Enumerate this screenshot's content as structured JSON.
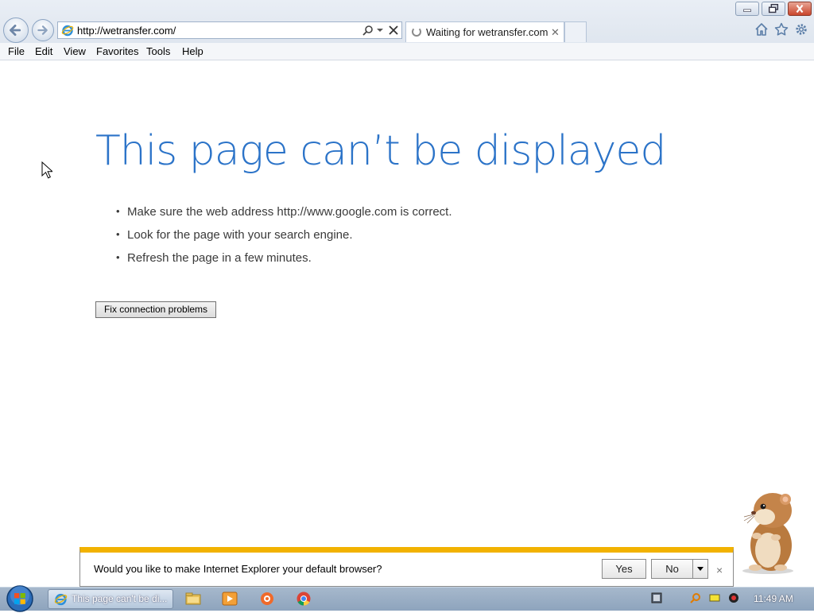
{
  "browser": {
    "address_url": "http://wetransfer.com/",
    "tab_title": "Waiting for wetransfer.com",
    "tab_close": "✕"
  },
  "menu": {
    "items": [
      "File",
      "Edit",
      "View",
      "Favorites",
      "Tools",
      "Help"
    ]
  },
  "error_page": {
    "heading": "This page can’t be displayed",
    "suggestions": [
      "Make sure the web address http://www.google.com is correct.",
      "Look for the page with your search engine.",
      "Refresh the page in a few minutes."
    ],
    "fix_button_label": "Fix connection problems"
  },
  "notification": {
    "message": "Would you like to make Internet Explorer your default browser?",
    "yes_label": "Yes",
    "no_label": "No",
    "close_glyph": "×"
  },
  "taskbar": {
    "active_window_label": "This page can't be di...",
    "clock": "11:49 AM"
  },
  "colors": {
    "heading_blue": "#2b73c8",
    "notification_accent": "#f2b200",
    "close_button_red": "#c9462c"
  },
  "icons": {
    "nav": [
      "back-arrow-icon",
      "forward-arrow-icon"
    ],
    "toolbar": [
      "home-icon",
      "favorites-star-icon",
      "tools-gear-icon"
    ],
    "taskbar_pins": [
      "file-explorer-icon",
      "media-player-icon",
      "security-app-icon",
      "chrome-icon"
    ],
    "tray": [
      "network-icon",
      "search-tray-icon",
      "notification-flag-icon",
      "volume-icon"
    ]
  }
}
